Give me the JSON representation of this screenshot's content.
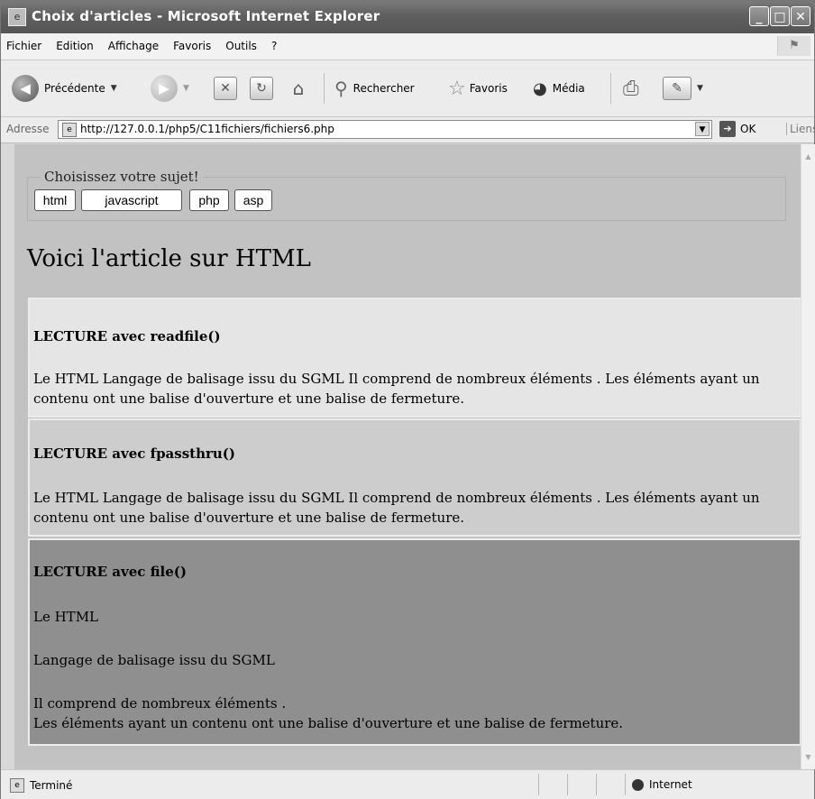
{
  "window": {
    "title": "Choix d'articles - Microsoft Internet Explorer"
  },
  "menu": [
    "Fichier",
    "Edition",
    "Affichage",
    "Favoris",
    "Outils",
    "?"
  ],
  "toolbar": {
    "back_label": "Précédente",
    "search_label": "Rechercher",
    "favorites_label": "Favoris",
    "media_label": "Média"
  },
  "address": {
    "label": "Adresse",
    "url": "http://127.0.0.1/php5/C11fichiers/fichiers6.php",
    "go_label": "OK",
    "links_label": "Liens"
  },
  "page": {
    "legend": "Choisissez votre sujet!",
    "subjects": [
      "html",
      "javascript",
      "php",
      "asp"
    ],
    "heading": "Voici l'article sur HTML",
    "sections": [
      {
        "title": "LECTURE avec readfile()",
        "text": "Le HTML Langage de balisage issu du SGML Il comprend de nombreux éléments . Les éléments ayant un contenu ont une balise d'ouverture et une balise de fermeture."
      },
      {
        "title": "LECTURE avec fpassthru()",
        "text": "Le HTML Langage de balisage issu du SGML Il comprend de nombreux éléments . Les éléments ayant un contenu ont une balise d'ouverture et une balise de fermeture."
      },
      {
        "title": "LECTURE avec file()",
        "lines": [
          "Le HTML",
          "Langage de balisage issu du SGML",
          "Il comprend de nombreux éléments .",
          "Les éléments ayant un contenu ont une balise d'ouverture et une balise de fermeture."
        ]
      }
    ]
  },
  "status": {
    "text": "Terminé",
    "zone": "Internet"
  }
}
